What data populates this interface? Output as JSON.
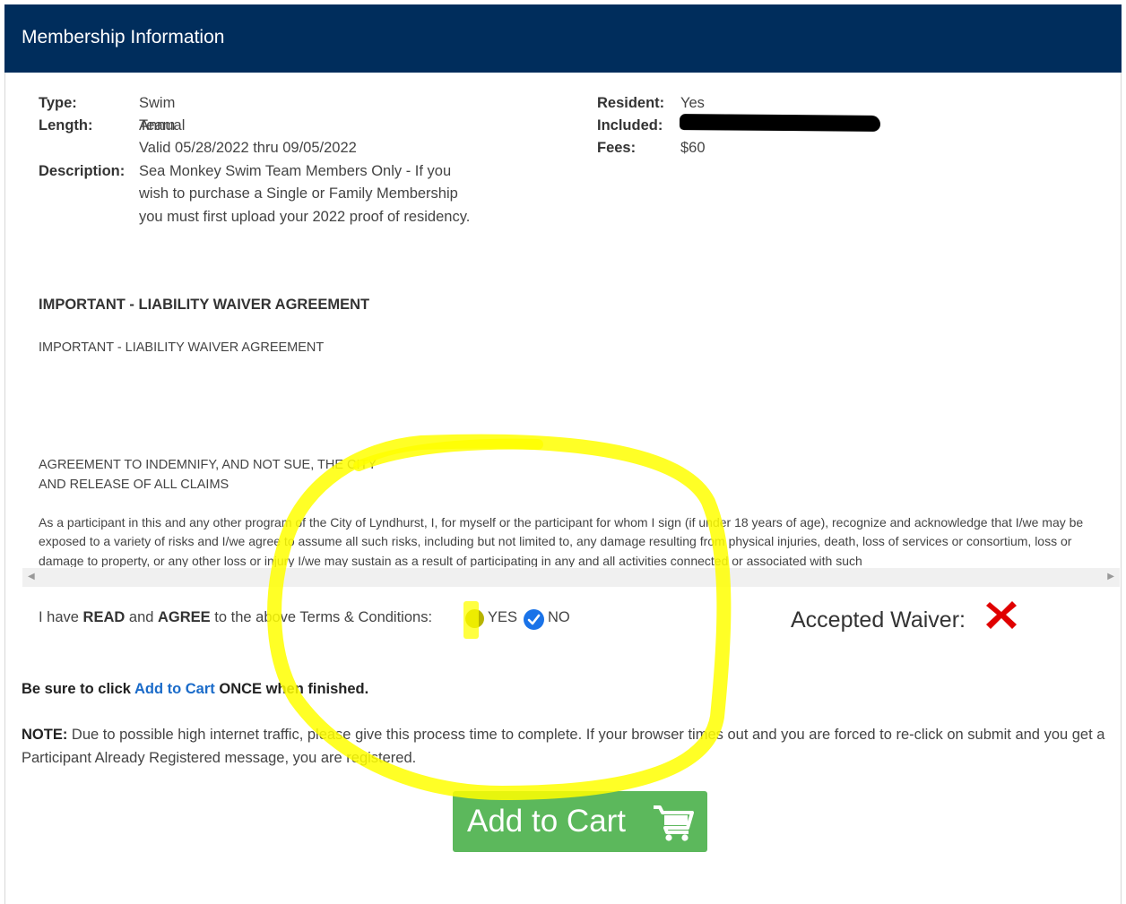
{
  "header": {
    "title": "Membership Information"
  },
  "details": {
    "type_label": "Type:",
    "type_value": "Swim Team",
    "length_label": "Length:",
    "length_value": "Annual",
    "valid_value": "Valid 05/28/2022 thru 09/05/2022",
    "description_label": "Description:",
    "description_line1": "Sea Monkey Swim Team Members Only - If you",
    "description_line2": "wish to purchase a Single or Family Membership",
    "description_line3": "you must first upload your 2022 proof of residency.",
    "resident_label": "Resident:",
    "resident_value": "Yes",
    "included_label": "Included:",
    "fees_label": "Fees:",
    "fees_value": "$60"
  },
  "waiver": {
    "title": "IMPORTANT - LIABILITY WAIVER AGREEMENT",
    "subtitle": "IMPORTANT - LIABILITY WAIVER AGREEMENT",
    "agreement_line1": "AGREEMENT TO INDEMNIFY, AND NOT SUE, THE CITY",
    "agreement_line2": "AND RELEASE OF ALL CLAIMS",
    "paragraph": "As a participant in this and any other program of the City of Lyndhurst, I, for myself or the participant for whom I sign (if under 18 years of age), recognize and acknowledge that I/we may be exposed to a variety of risks and I/we agree to assume all such risks, including but not limited to, any damage resulting from physical injuries, death, loss of services or consortium, loss or damage to property, or any other loss or injury I/we may sustain as a result of participating in any and all activities connected or associated with such"
  },
  "terms": {
    "prefix": "I have ",
    "read": "READ",
    "and": " and ",
    "agree": "AGREE",
    "suffix": " to the above Terms & Conditions:",
    "yes_label": "YES",
    "no_label": "NO",
    "selected": "NO"
  },
  "accepted": {
    "label": "Accepted Waiver:",
    "icon": "red-x-icon",
    "color": "#e00000"
  },
  "instructions": {
    "sure_prefix": "Be sure to click ",
    "sure_link": "Add to Cart",
    "sure_suffix": " ONCE when finished.",
    "note_label": "NOTE:",
    "note_text": " Due to possible high internet traffic, please give this process time to complete. If your browser times out and you are forced to re-click on submit and you get a Participant Already Registered message, you are registered."
  },
  "cart_button": {
    "label": "Add to Cart",
    "icon": "shopping-cart-icon",
    "color": "#5cb85c"
  },
  "colors": {
    "header_bg": "#002d5c",
    "highlight": "#ffff00",
    "radio_checked": "#1a73e8"
  }
}
